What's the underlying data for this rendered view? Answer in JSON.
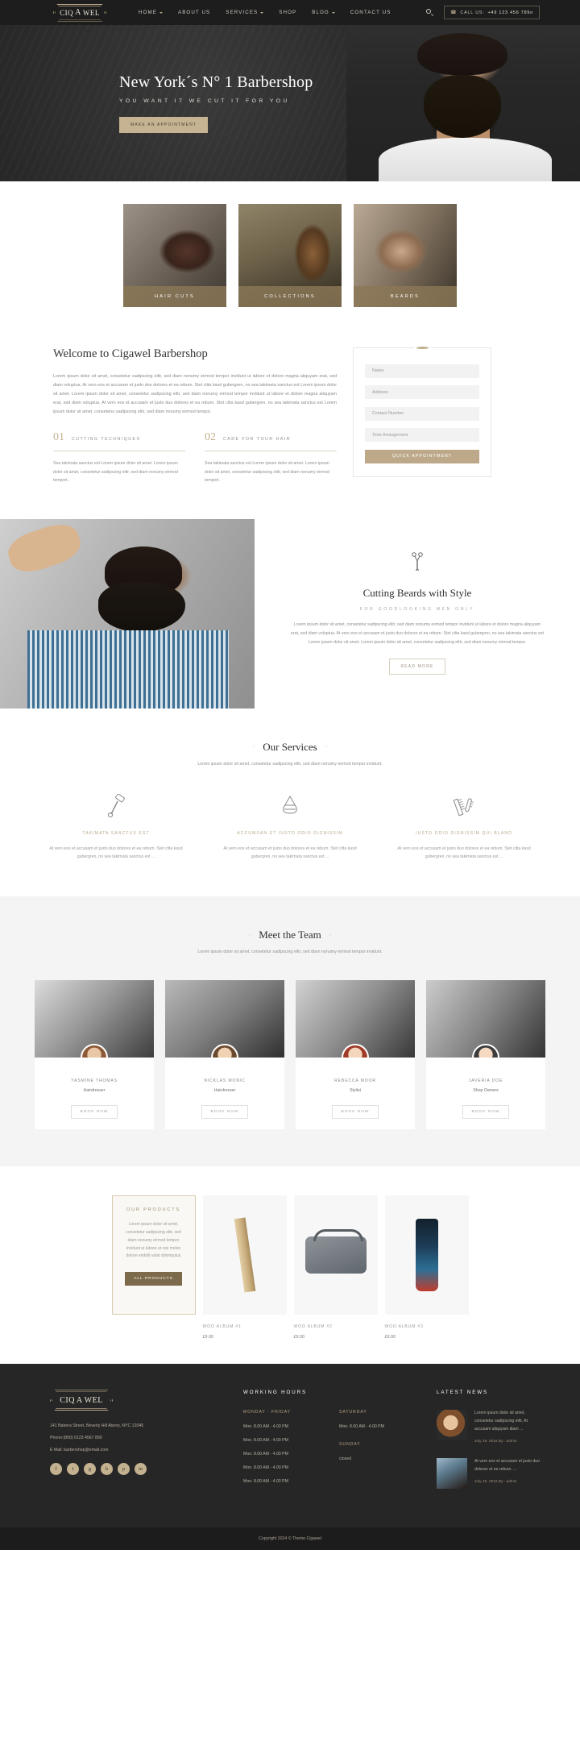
{
  "header": {
    "logo": {
      "left": "CIQ",
      "mid": "A",
      "right": "WEL"
    },
    "nav": [
      {
        "label": "HOME",
        "caret": true
      },
      {
        "label": "ABOUT US",
        "caret": false
      },
      {
        "label": "SERVICES",
        "caret": true
      },
      {
        "label": "SHOP",
        "caret": false
      },
      {
        "label": "BLOG",
        "caret": true
      },
      {
        "label": "CONTACT US",
        "caret": false
      }
    ],
    "search_icon": "search-icon",
    "call": {
      "icon": "phone-icon",
      "label": "CALL US:",
      "number": "+49 123 456 789o"
    }
  },
  "hero": {
    "title": "New York´s N° 1 Barbershop",
    "subtitle": "YOU WANT IT WE CUT IT FOR YOU",
    "button": "MAKE AN APPOINTMENT"
  },
  "cards": [
    {
      "label": "HAIR CUTS"
    },
    {
      "label": "COLLECTIONS"
    },
    {
      "label": "BEARDS"
    }
  ],
  "welcome": {
    "title": "Welcome to Cigawel Barbershop",
    "paragraph": "Lorem ipsum dolor sit amet, consetetur sadipscing elitr, sed diam nonumy eirmod tempor invidunt ut labore et dolore magna aliquyam erat, sed diam voluptua. At vero eos et accusam et justo duo dolores et ea rebum. Stet clita kasd gubergren, no sea takimata sanctus est Lorem ipsum dolor sit amet. Lorem ipsum dolor sit amet, consetetur sadipscing elitr, sed diam nonumy eirmod tempor invidunt ut labore et dolore magna aliquyam erat, sed diam voluptua. At vero eos et accusam et justo duo dolores et ea rebum. Stet clita kasd gubergren, no sea takimata sanctus est Lorem ipsum dolor sit amet, consetetur sadipscing elitr, sed diam nonumy eirmod tempor.",
    "items": [
      {
        "num": "01",
        "label": "CUTTING TECHNIQUES",
        "text": "Sea takimata sanctus est Lorem ipsum dolor sit amet. Lorem ipsum dolor sit amet, consetetur sadipscing elitr, sed diam nonumy eirmod temport."
      },
      {
        "num": "02",
        "label": "CARE FOR YOUR HAIR",
        "text": "Sea takimata sanctus est Lorem ipsum dolor sit amet. Lorem ipsum dolor sit amet, consetetur sadipscing elitr, sed diam nonumy eirmod temport."
      }
    ]
  },
  "appointment_form": {
    "fields": [
      {
        "name": "name",
        "placeholder": "Name",
        "value": ""
      },
      {
        "name": "address",
        "placeholder": "Address",
        "value": ""
      },
      {
        "name": "contact",
        "placeholder": "Contact Number",
        "value": ""
      },
      {
        "name": "time",
        "placeholder": "Time Arrangement",
        "value": ""
      }
    ],
    "submit": "QUICK APPOINTMENT"
  },
  "beards": {
    "icon": "scissors-icon",
    "title": "Cutting Beards with Style",
    "subtitle": "FOR GOODLOOKING MEN ONLY",
    "paragraph": "Lorem ipsum dolor sit amet, consetetur sadipscing elitr, sed diam nonumy eirmod tempor invidunt ut labore et dolore magna aliquyam erat, sed diam voluptua. At vero eos et accusam et justo duo dolores et ea rebum. Stet clita kasd gubergren, no sea takimata sanctus est Lorem ipsum dolor sit amet. Lorem ipsum dolor sit amet, consetetur sadipscing elitr, sed diam nonumy eirmod tempor.",
    "button": "READ MORE"
  },
  "services": {
    "heading": "Our Services",
    "subheading": "Lorem ipsum dolor sit amet, consetetur sadipscing elitr, sed diam nonumy eirmod tempor invidunt.",
    "items": [
      {
        "icon": "razor-icon",
        "title": "TAKIMATA SANCTUS EST",
        "text": "At vero eos et accusam et justo duo dolores et ea rebum. Stet clita kasd gubergren, no sea takimata sanctus est ..."
      },
      {
        "icon": "shaving-cream-icon",
        "title": "ACCUMSAN ET IUSTO ODIO DIGNISSIM",
        "text": "At vero eos et accusam et justo duo dolores et ea rebum. Stet clita kasd gubergren, no sea takimata sanctus est ..."
      },
      {
        "icon": "comb-brush-icon",
        "title": "IUSTO ODIO DIGNISSIM QUI BLAND",
        "text": "At vero eos et accusam et justo duo dolores et ea rebum. Stet clita kasd gubergren, no sea takimata sanctus est ..."
      }
    ]
  },
  "team": {
    "heading": "Meet the Team",
    "subheading": "Lorem ipsum dolor sit amet, consetetur sadipscing elitr, sed diam nonumy eirmod tempor invidunt.",
    "members": [
      {
        "name": "YASMINE THOMAS",
        "role": "Hairdresser",
        "button": "BOOK NOW"
      },
      {
        "name": "NICKLAS MONIC",
        "role": "Hairdresser",
        "button": "BOOK NOW"
      },
      {
        "name": "REBECCA MOOR",
        "role": "Stylist",
        "button": "BOOK NOW"
      },
      {
        "name": "JAVERIA DOE",
        "role": "Shop Owners",
        "button": "BOOK NOW"
      }
    ]
  },
  "products": {
    "promo": {
      "title": "OUR PRODUCTS",
      "text": "Lorem ipsum dolor sit amet, consetetur sadipscing elitr, sed diam nonumy eirmod tempor invidunt ut labore et nisi molon dolore endolit volat doloriqutus",
      "button": "ALL PRODUCTS"
    },
    "items": [
      {
        "name": "WOO ALBUM #1",
        "price": "£9.00"
      },
      {
        "name": "WOO ALBUM #2",
        "price": "£9.00"
      },
      {
        "name": "WOO ALBUM #3",
        "price": "£9.00"
      }
    ]
  },
  "footer": {
    "logo": {
      "left": "CIQ",
      "mid": "A",
      "right": "WEL"
    },
    "address": "141 Babera Street, Beverly Hill Abony, NYC 12045",
    "phone": "Phone:(800) 0123 4567 890",
    "email": "E Mail: barbershop@email.com",
    "socials": [
      "f",
      "t",
      "g",
      "b",
      "p",
      "in"
    ],
    "hours_heading": "WORKING HOURS",
    "weekday_label": "MONDAY - FRIDAY",
    "weekday_rows": [
      "Mon. 8.00 AM - 4.00 PM",
      "Mon. 8.00 AM - 4.00 PM",
      "Mon. 8.00 AM - 4.00 PM",
      "Mon. 8.00 AM - 4.00 PM",
      "Mon. 8.00 AM - 4.00 PM"
    ],
    "saturday_label": "SATURDAY",
    "saturday_value": "Mon. 8.00 AM - 4.00 PM",
    "sunday_label": "SUNDAY",
    "sunday_value": "closed",
    "news_heading": "LATEST NEWS",
    "news": [
      {
        "text": "Lorem ipsum dolor sit amet, consetetur sadipscing elitr, At accusam aliquyam diam ...",
        "meta": "July 19, 2016 By : admin"
      },
      {
        "text": "At vero eos et accusam et justo duo dolores et ea rebum. ...",
        "meta": "July 19, 2016 By : admin"
      }
    ],
    "copyright": "Copyright 2024 © Theme Cigawel"
  },
  "colors": {
    "gold": "#c3b190",
    "dark": "#1d1d1d",
    "footer": "#262626"
  }
}
